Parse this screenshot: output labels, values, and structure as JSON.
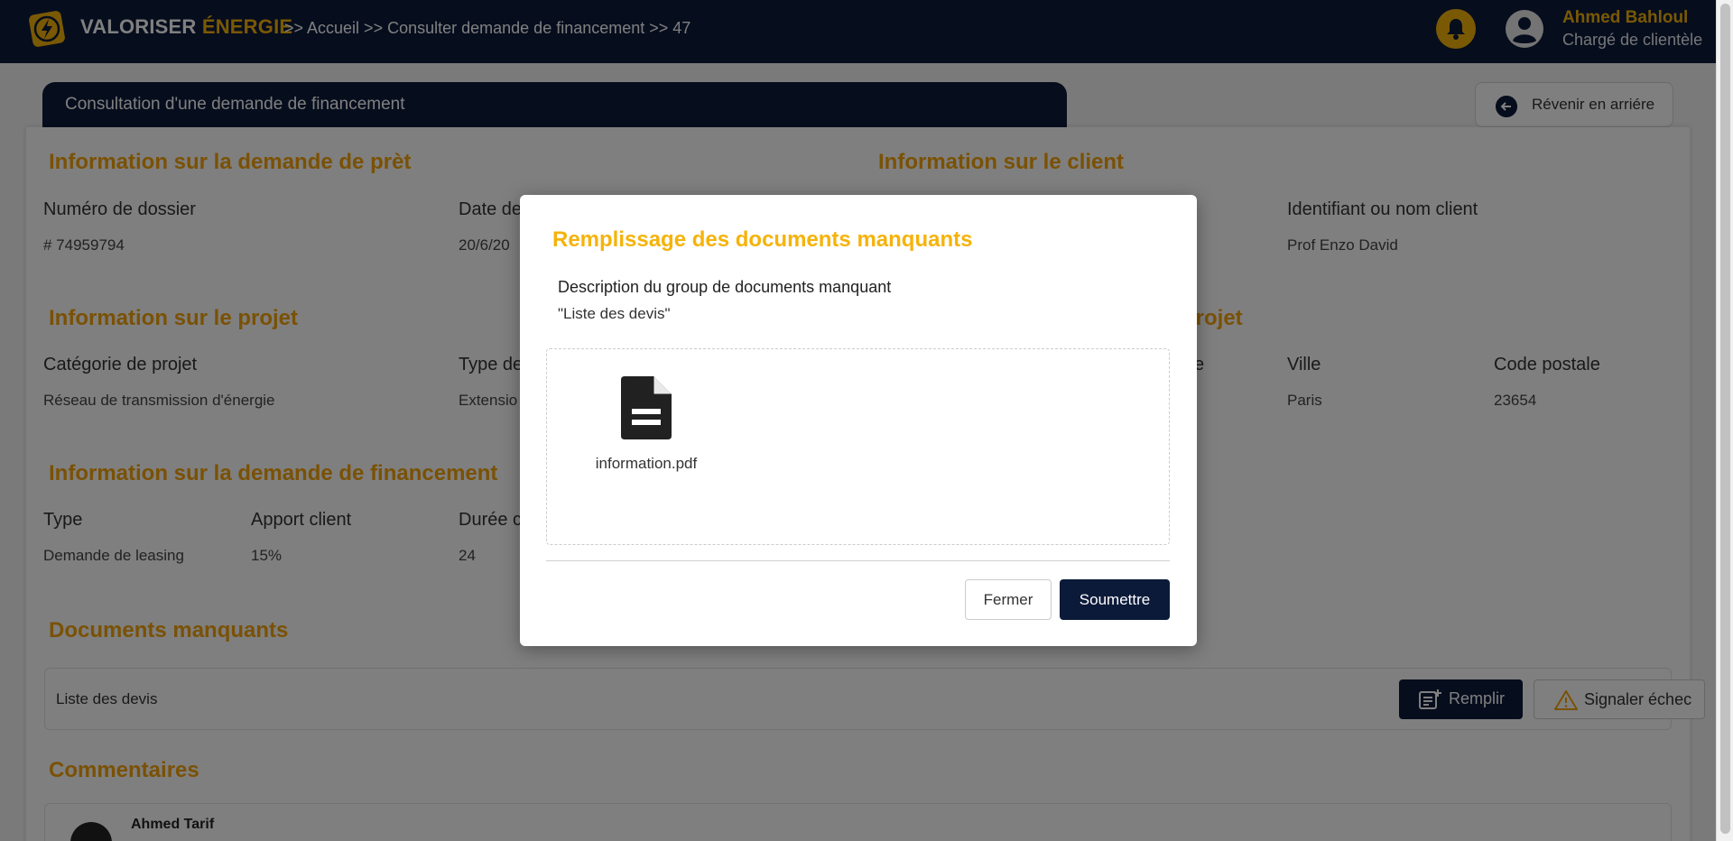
{
  "brand": {
    "word1": "VALORISER",
    "word2": "ÉNERGIE",
    "accent": "#f5b30a",
    "navy": "#0c1a3a"
  },
  "breadcrumb": ">> Accueil >> Consulter demande de financement >> 47",
  "user": {
    "name": "Ahmed Bahloul",
    "role": "Chargé de clientèle"
  },
  "page": {
    "title": "Consultation d'une demande de financement",
    "back_label": "Révenir en arriére"
  },
  "sections": {
    "loan": {
      "title": "Information sur la demande de prèt",
      "dossier_label": "Numéro de dossier",
      "dossier_value": "# 74959794",
      "date_label": "Date de",
      "date_value": "20/6/20"
    },
    "client": {
      "title": "Information sur le client",
      "id_label": "Identifiant ou nom client",
      "id_value": "Prof Enzo David"
    },
    "project": {
      "title": "Information sur le projet",
      "category_label": "Catégorie de projet",
      "category_value": "Réseau de transmission d'énergie",
      "type_label": "Type de",
      "type_value": "Extensio"
    },
    "project_location": {
      "title_partial": "projet",
      "label_partial": "e",
      "city_label": "Ville",
      "city_value": "Paris",
      "postal_label": "Code postale",
      "postal_value": "23654"
    },
    "financing": {
      "title": "Information sur la demande de financement",
      "type_label": "Type",
      "type_value": "Demande de leasing",
      "apport_label": "Apport client",
      "apport_value": "15%",
      "duree_label": "Durée c",
      "duree_value": "24"
    },
    "missing_docs": {
      "title": "Documents manquants",
      "item": "Liste des devis",
      "fill_label": "Remplir",
      "fail_label": "Signaler échec"
    },
    "comments": {
      "title": "Commentaires",
      "author_partial": "Ahmed Tarif"
    }
  },
  "modal": {
    "title": "Remplissage des documents manquants",
    "description": "Description du group de documents manquant",
    "group_name": "\"Liste des devis\"",
    "file_name": "information.pdf",
    "close_label": "Fermer",
    "submit_label": "Soumettre"
  }
}
